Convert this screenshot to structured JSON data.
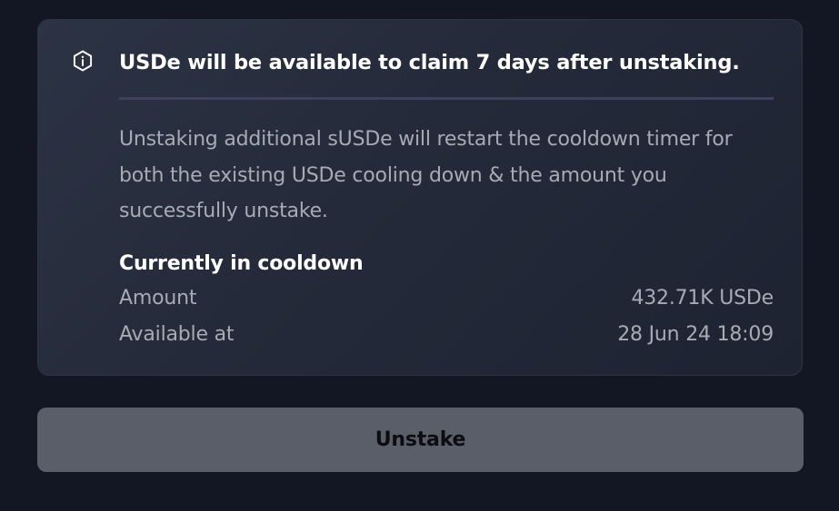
{
  "notice": {
    "icon": "info-icon",
    "headline": "USDe will be available to claim 7 days after unstaking.",
    "description": "Unstaking additional sUSDe will restart the cooldown timer for both the existing USDe cooling down & the amount you successfully unstake."
  },
  "cooldown": {
    "title": "Currently in cooldown",
    "rows": [
      {
        "label": "Amount",
        "value": "432.71K USDe"
      },
      {
        "label": "Available at",
        "value": "28 Jun 24 18:09"
      }
    ]
  },
  "actions": {
    "unstake_label": "Unstake"
  },
  "colors": {
    "background": "#121723",
    "card_border": "#2d3442",
    "divider": "#413f5e",
    "muted_text": "#a7abb5",
    "button_bg": "#5a5e69"
  }
}
